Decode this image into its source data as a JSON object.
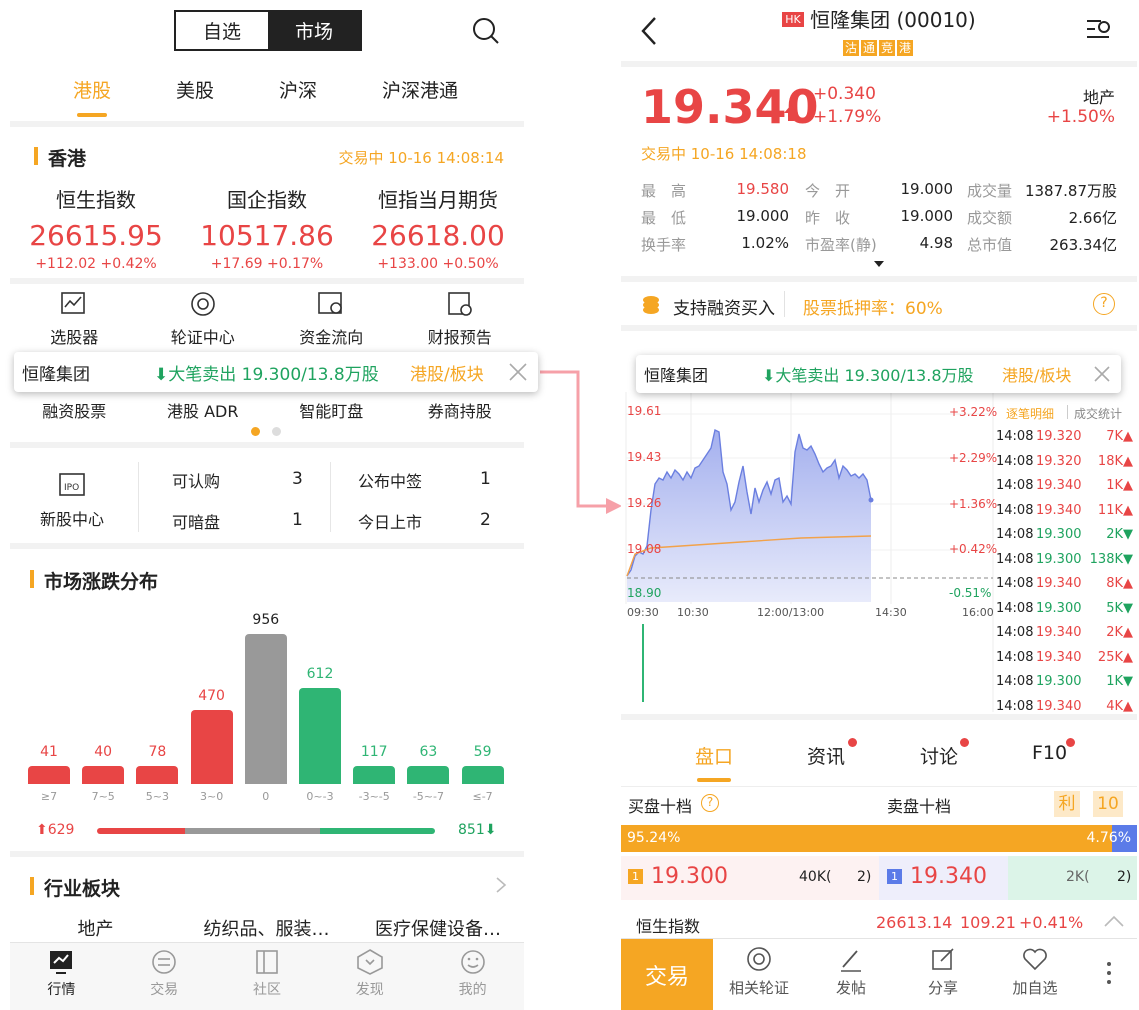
{
  "left": {
    "header": {
      "seg": [
        "自选",
        "市场"
      ]
    },
    "market_tabs": [
      "港股",
      "美股",
      "沪深",
      "沪深港通"
    ],
    "hk": {
      "title": "香港",
      "status": "交易中 10-16 14:08:14",
      "indices": [
        {
          "name": "恒生指数",
          "value": "26615.95",
          "change": "+112.02 +0.42%"
        },
        {
          "name": "国企指数",
          "value": "10517.86",
          "change": "+17.69 +0.17%"
        },
        {
          "name": "恒指当月期货",
          "value": "26618.00",
          "change": "+133.00 +0.50%"
        }
      ]
    },
    "tools_row1": [
      "选股器",
      "轮证中心",
      "资金流向",
      "财报预告"
    ],
    "tools_row2": [
      "融资股票",
      "港股 ADR",
      "智能盯盘",
      "券商持股"
    ],
    "ipo": {
      "label": "新股中心",
      "items": [
        {
          "label": "可认购",
          "value": "3"
        },
        {
          "label": "公布中签",
          "value": "1"
        },
        {
          "label": "可暗盘",
          "value": "1"
        },
        {
          "label": "今日上市",
          "value": "2"
        }
      ]
    },
    "dist": {
      "title": "市场涨跌分布",
      "up_total": "629",
      "down_total": "851",
      "up_arrow": "⬆",
      "down_arrow": "⬇"
    },
    "sector": {
      "title": "行业板块",
      "items": [
        "地产",
        "纺织品、服装…",
        "医疗保健设备…"
      ]
    },
    "bottom_nav": [
      "行情",
      "交易",
      "社区",
      "发现",
      "我的"
    ]
  },
  "popup": {
    "name": "恒隆集团",
    "action": "⬇大笔卖出 19.300/13.8万股",
    "link": "港股/板块"
  },
  "right": {
    "title": "恒隆集团 (00010)",
    "hk_badge": "HK",
    "tags": [
      "沽",
      "通",
      "竞",
      "港"
    ],
    "price": "19.340",
    "change": "+0.340",
    "change_pct": "+1.79%",
    "sector_name": "地产",
    "sector_pct": "+1.50%",
    "status": "交易中 10-16 14:08:18",
    "stats": [
      {
        "l": "最　高",
        "v": "19.580",
        "red": true
      },
      {
        "l": "今　开",
        "v": "19.000"
      },
      {
        "l": "成交量",
        "v": "1387.87万股"
      },
      {
        "l": "最　低",
        "v": "19.000"
      },
      {
        "l": "昨　收",
        "v": "19.000"
      },
      {
        "l": "成交额",
        "v": "2.66亿"
      },
      {
        "l": "换手率",
        "v": "1.02%"
      },
      {
        "l": "市盈率(静)",
        "v": "4.98"
      },
      {
        "l": "总市值",
        "v": "263.34亿"
      }
    ],
    "margin": {
      "left": "支持融资买入",
      "right": "股票抵押率：60%",
      "help": "?"
    },
    "chart": {
      "y_left": [
        "19.61",
        "19.43",
        "19.26",
        "19.08",
        "18.90"
      ],
      "y_right": [
        "+3.22%",
        "+2.29%",
        "+1.36%",
        "+0.42%",
        "-0.51%"
      ],
      "x": [
        "09:30",
        "10:30",
        "12:00/13:00",
        "14:30",
        "16:00"
      ],
      "tab_a": "逐笔明细",
      "tab_b": "成交统计"
    },
    "ticks": [
      {
        "t": "14:08",
        "p": "19.320",
        "v": "7K",
        "d": "up"
      },
      {
        "t": "14:08",
        "p": "19.320",
        "v": "18K",
        "d": "up"
      },
      {
        "t": "14:08",
        "p": "19.340",
        "v": "1K",
        "d": "up"
      },
      {
        "t": "14:08",
        "p": "19.340",
        "v": "11K",
        "d": "up"
      },
      {
        "t": "14:08",
        "p": "19.300",
        "v": "2K",
        "d": "dn"
      },
      {
        "t": "14:08",
        "p": "19.300",
        "v": "138K",
        "d": "dn"
      },
      {
        "t": "14:08",
        "p": "19.340",
        "v": "8K",
        "d": "up"
      },
      {
        "t": "14:08",
        "p": "19.300",
        "v": "5K",
        "d": "dn"
      },
      {
        "t": "14:08",
        "p": "19.340",
        "v": "2K",
        "d": "up"
      },
      {
        "t": "14:08",
        "p": "19.340",
        "v": "25K",
        "d": "up"
      },
      {
        "t": "14:08",
        "p": "19.300",
        "v": "1K",
        "d": "dn"
      },
      {
        "t": "14:08",
        "p": "19.340",
        "v": "4K",
        "d": "up"
      }
    ],
    "sub_tabs": [
      "盘口",
      "资讯",
      "讨论",
      "F10"
    ],
    "book": {
      "buy_title": "买盘十档",
      "sell_title": "卖盘十档",
      "btn_a": "利",
      "btn_b": "10",
      "buy_pct": "95.24%",
      "sell_pct": "4.76%",
      "buy_price": "19.300",
      "buy_vol": "40K(",
      "buy_cnt": "2)",
      "sell_price": "19.340",
      "sell_vol": "2K(",
      "sell_cnt": "2)",
      "level": "1"
    },
    "ticker": {
      "name": "恒生指数",
      "value": "26613.14",
      "chg": "109.21",
      "pct": "+0.41%"
    },
    "bottom": {
      "trade": "交易",
      "items": [
        "相关轮证",
        "发帖",
        "分享",
        "加自选"
      ]
    }
  },
  "chart_data": {
    "type": "bar",
    "categories": [
      "≥7",
      "7~5",
      "5~3",
      "3~0",
      "0",
      "0~-3",
      "-3~-5",
      "-5~-7",
      "≤-7"
    ],
    "values": [
      41,
      40,
      78,
      470,
      956,
      612,
      117,
      63,
      59
    ],
    "colors": [
      "#e84545",
      "#e84545",
      "#e84545",
      "#e84545",
      "#999999",
      "#2fb574",
      "#2fb574",
      "#2fb574",
      "#2fb574"
    ],
    "title": "市场涨跌分布",
    "ylim": [
      0,
      956
    ]
  }
}
